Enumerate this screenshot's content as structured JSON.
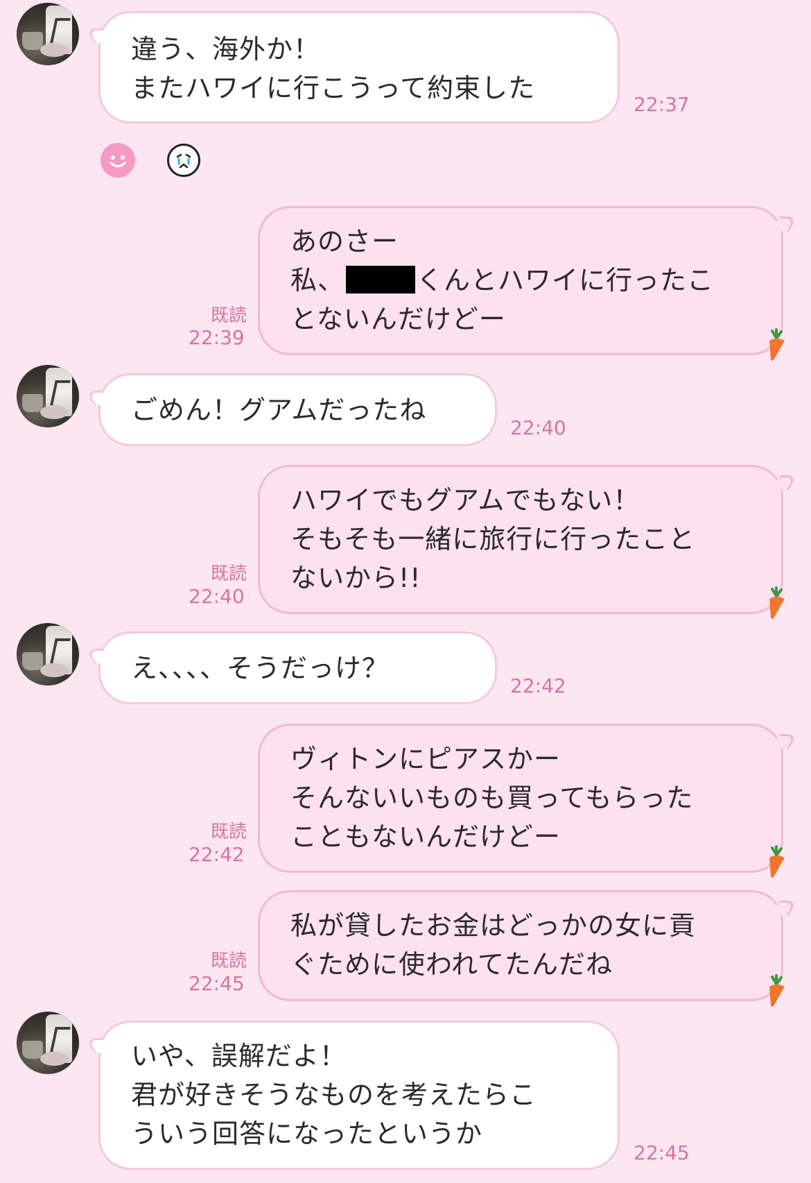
{
  "messages": [
    {
      "side": "in",
      "lines": [
        "違う、海外か！",
        "またハワイに行こうって約束した"
      ],
      "time": "22:37"
    },
    {
      "side": "out",
      "lines": [
        "あのさー",
        "私、▇くんとハワイに行ったこ",
        "とないんだけどー"
      ],
      "read": "既読",
      "time": "22:39"
    },
    {
      "side": "in",
      "lines": [
        "ごめん！グアムだったね"
      ],
      "time": "22:40"
    },
    {
      "side": "out",
      "lines": [
        "ハワイでもグアムでもない！",
        "そもそも一緒に旅行に行ったこと",
        "ないから!!"
      ],
      "read": "既読",
      "time": "22:40"
    },
    {
      "side": "in",
      "lines": [
        "え、、、、そうだっけ？"
      ],
      "time": "22:42"
    },
    {
      "side": "out",
      "lines": [
        "ヴィトンにピアスかー",
        "そんないいものも買ってもらった",
        "こともないんだけどー"
      ],
      "read": "既読",
      "time": "22:42"
    },
    {
      "side": "out",
      "lines": [
        "私が貸したお金はどっかの女に貢",
        "ぐために使われてたんだね"
      ],
      "read": "既読",
      "time": "22:45"
    },
    {
      "side": "in",
      "lines": [
        "いや、誤解だよ！",
        "君が好きそうなものを考えたらこ",
        "ういう回答になったというか"
      ],
      "time": "22:45"
    }
  ],
  "reactions": [
    "smile-icon",
    "crying-face-icon"
  ],
  "colors": {
    "background": "#fbe6f1",
    "incoming_bubble": "#ffffff",
    "outgoing_bubble": "#fde1ee",
    "accent_text": "#d674a0"
  }
}
